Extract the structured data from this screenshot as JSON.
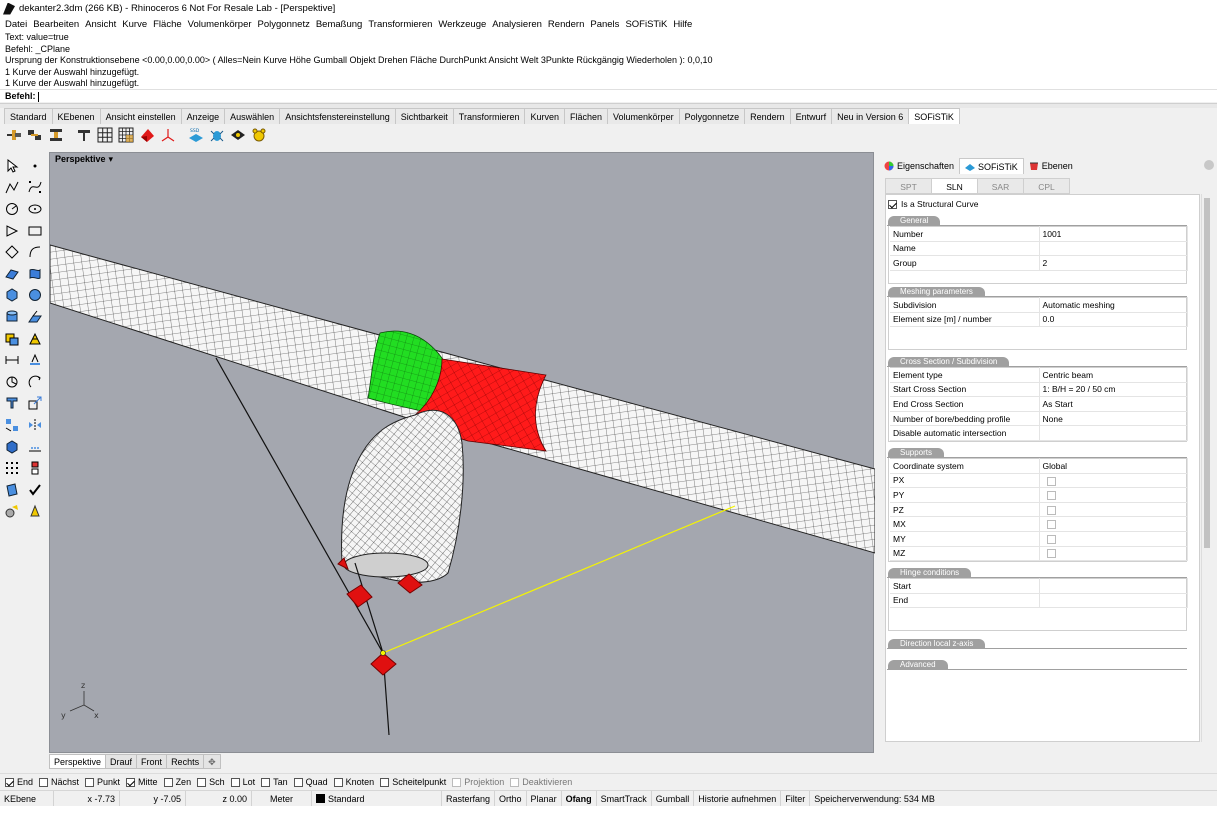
{
  "title": "dekanter2.3dm (266 KB) - Rhinoceros 6 Not For Resale Lab - [Perspektive]",
  "menu": [
    "Datei",
    "Bearbeiten",
    "Ansicht",
    "Kurve",
    "Fläche",
    "Volumenkörper",
    "Polygonnetz",
    "Bemaßung",
    "Transformieren",
    "Werkzeuge",
    "Analysieren",
    "Rendern",
    "Panels",
    "SOFiSTiK",
    "Hilfe"
  ],
  "command_history": [
    "Text: value=true",
    "Befehl: _CPlane",
    "Ursprung der Konstruktionsebene <0.00,0.00,0.00> ( Alles=Nein  Kurve  Höhe  Gumball  Objekt  Drehen  Fläche  DurchPunkt  Ansicht  Welt  3Punkte  Rückgängig  Wiederholen ): 0,0,10",
    "1 Kurve der Auswahl hinzugefügt.",
    "1 Kurve der Auswahl hinzugefügt."
  ],
  "command_prompt": "Befehl:",
  "toolbar_tabs": [
    "Standard",
    "KEbenen",
    "Ansicht einstellen",
    "Anzeige",
    "Auswählen",
    "Ansichtsfenstereinstellung",
    "Sichtbarkeit",
    "Transformieren",
    "Kurven",
    "Flächen",
    "Volumenkörper",
    "Polygonnetze",
    "Rendern",
    "Entwurf",
    "Neu in Version 6",
    "SOFiSTiK"
  ],
  "toolbar_tab_active": "SOFiSTiK",
  "toolbar_icons": [
    "sofistik-structural-point-icon",
    "sofistik-structural-line-icon",
    "sofistik-section-icon",
    "sofistik-support-icon",
    "sofistik-grid-icon",
    "sofistik-mesh-icon",
    "sofistik-area-icon",
    "sofistik-load-icon",
    "sofistik-axis-icon",
    "sofistik-ssd-icon",
    "sofistik-bug-icon",
    "sofistik-wizard-icon",
    "sofistik-bear-icon"
  ],
  "viewport": {
    "name": "Perspektive",
    "axis_labels": {
      "x": "x",
      "y": "y",
      "z": "z"
    }
  },
  "viewport_tabs": [
    "Perspektive",
    "Drauf",
    "Front",
    "Rechts"
  ],
  "viewport_tab_active": "Perspektive",
  "panel": {
    "tabs": [
      "Eigenschaften",
      "SOFiSTiK",
      "Ebenen"
    ],
    "active_tab": "SOFiSTiK",
    "subtabs": [
      "SPT",
      "SLN",
      "SAR",
      "CPL"
    ],
    "active_subtab": "SLN",
    "structural_curve_label": "Is a Structural Curve",
    "structural_curve_checked": true,
    "sections": {
      "general": {
        "title": "General",
        "rows": [
          [
            "Number",
            "1001"
          ],
          [
            "Name",
            ""
          ],
          [
            "Group",
            "2"
          ]
        ]
      },
      "meshing": {
        "title": "Meshing parameters",
        "rows": [
          [
            "Subdivision",
            "Automatic meshing"
          ],
          [
            "Element size [m] / number",
            "0.0"
          ]
        ]
      },
      "cross": {
        "title": "Cross Section / Subdivision",
        "rows": [
          [
            "Element type",
            "Centric beam"
          ],
          [
            "Start Cross Section",
            "1: B/H = 20 / 50 cm"
          ],
          [
            "End Cross Section",
            "As Start"
          ],
          [
            "Number of bore/bedding profile",
            "None"
          ],
          [
            "Disable automatic intersection",
            ""
          ]
        ]
      },
      "supports": {
        "title": "Supports",
        "rows": [
          [
            "Coordinate system",
            "Global"
          ],
          [
            "PX",
            ""
          ],
          [
            "PY",
            ""
          ],
          [
            "PZ",
            ""
          ],
          [
            "MX",
            ""
          ],
          [
            "MY",
            ""
          ],
          [
            "MZ",
            ""
          ]
        ]
      },
      "hinge": {
        "title": "Hinge conditions",
        "rows": [
          [
            "Start",
            ""
          ],
          [
            "End",
            ""
          ]
        ]
      },
      "direction": {
        "title": "Direction local z-axis"
      },
      "advanced": {
        "title": "Advanced"
      }
    }
  },
  "osnap": [
    {
      "label": "End",
      "checked": true,
      "enabled": true
    },
    {
      "label": "Nächst",
      "checked": false,
      "enabled": true
    },
    {
      "label": "Punkt",
      "checked": false,
      "enabled": true
    },
    {
      "label": "Mitte",
      "checked": true,
      "enabled": true
    },
    {
      "label": "Zen",
      "checked": false,
      "enabled": true
    },
    {
      "label": "Sch",
      "checked": false,
      "enabled": true
    },
    {
      "label": "Lot",
      "checked": false,
      "enabled": true
    },
    {
      "label": "Tan",
      "checked": false,
      "enabled": true
    },
    {
      "label": "Quad",
      "checked": false,
      "enabled": true
    },
    {
      "label": "Knoten",
      "checked": false,
      "enabled": true
    },
    {
      "label": "Scheitelpunkt",
      "checked": false,
      "enabled": true
    },
    {
      "label": "Projektion",
      "checked": false,
      "enabled": false
    },
    {
      "label": "Deaktivieren",
      "checked": false,
      "enabled": false
    }
  ],
  "status": {
    "cplane": "KEbene",
    "x": "x -7.73",
    "y": "y -7.05",
    "z": "z 0.00",
    "units": "Meter",
    "layer": "Standard",
    "toggles": [
      "Rasterfang",
      "Ortho",
      "Planar",
      "Ofang",
      "SmartTrack",
      "Gumball",
      "Historie aufnehmen",
      "Filter"
    ],
    "toggle_active": "Ofang",
    "memory": "Speicherverwendung: 534 MB"
  },
  "colors": {
    "viewport_bg": "#a4a7af",
    "selected_mesh": "#ff1a1a",
    "green_mesh": "#22dd22",
    "selection_line": "#f5f500"
  }
}
